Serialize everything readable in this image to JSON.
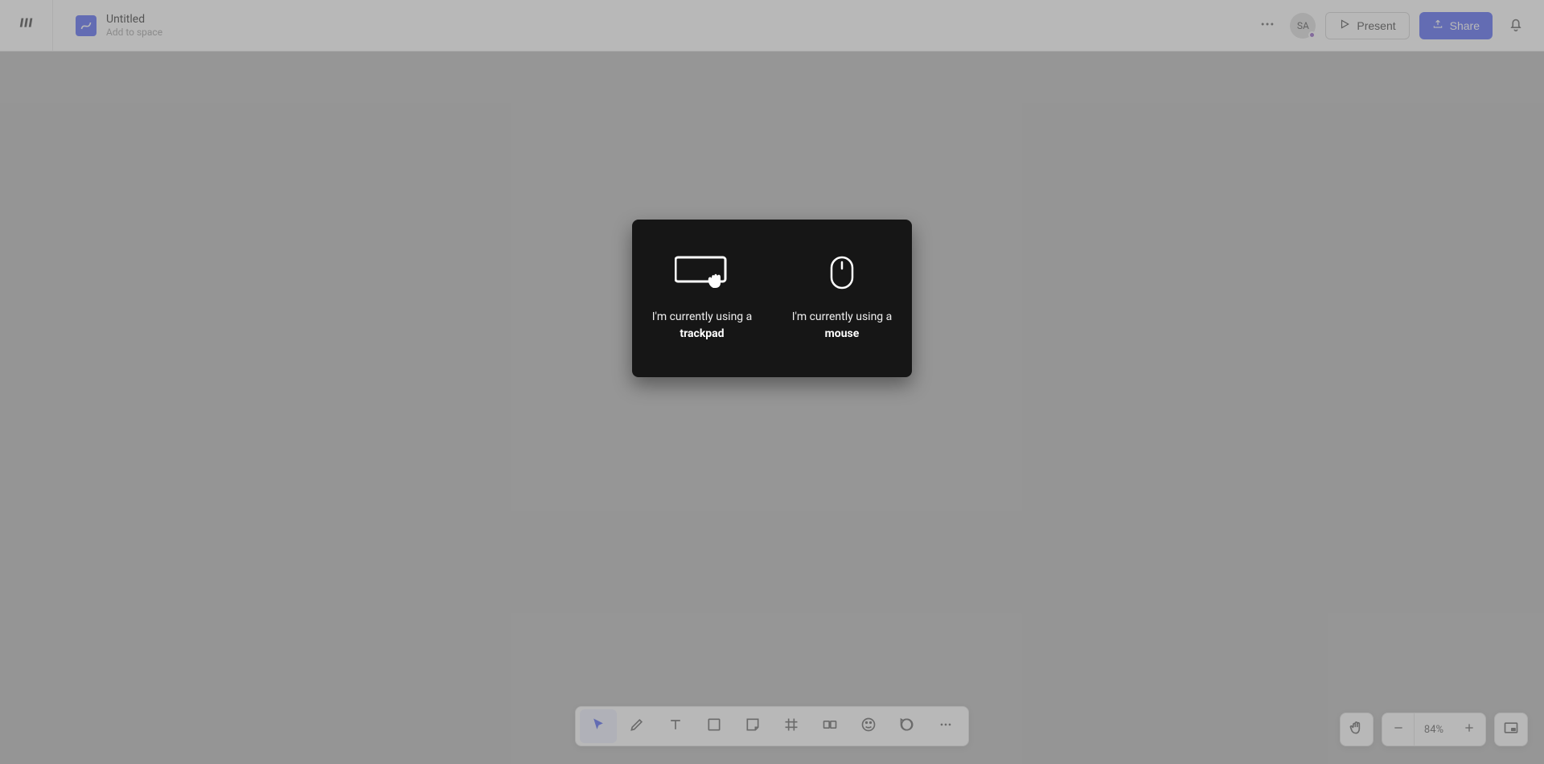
{
  "header": {
    "doc_title": "Untitled",
    "add_to_space": "Add to space",
    "avatar_initials": "SA",
    "present_label": "Present",
    "share_label": "Share"
  },
  "modal": {
    "trackpad": {
      "prefix": "I'm currently using a",
      "device": "trackpad"
    },
    "mouse": {
      "prefix": "I'm currently using a",
      "device": "mouse"
    }
  },
  "toolbar": {
    "items": [
      {
        "name": "select-tool",
        "active": true
      },
      {
        "name": "pen-tool",
        "active": false
      },
      {
        "name": "text-tool",
        "active": false
      },
      {
        "name": "rectangle-tool",
        "active": false
      },
      {
        "name": "sticky-note-tool",
        "active": false
      },
      {
        "name": "frame-tool",
        "active": false
      },
      {
        "name": "component-tool",
        "active": false
      },
      {
        "name": "color-tool",
        "active": false
      },
      {
        "name": "comment-tool",
        "active": false
      },
      {
        "name": "more-tools",
        "active": false
      }
    ]
  },
  "viewport": {
    "zoom_readout": "84%"
  },
  "colors": {
    "primary": "#4458f3",
    "modal_bg": "#161616",
    "canvas_bg": "#b3b3b3"
  }
}
